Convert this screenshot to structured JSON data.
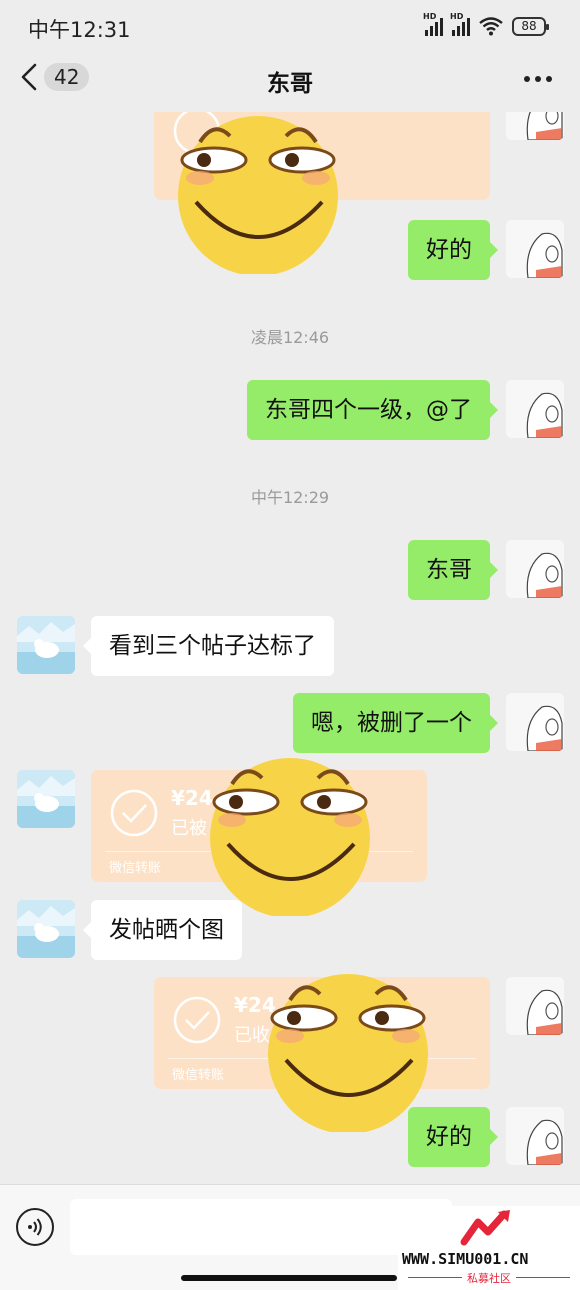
{
  "status_bar": {
    "time": "中午12:31",
    "signal_1_label": "HD",
    "signal_2_label": "HD",
    "wifi_icon": "wifi-icon",
    "battery_level": "88"
  },
  "nav": {
    "back_icon": "chevron-left-icon",
    "unread_count": "42",
    "title": "东哥",
    "more_icon": "more-dots-icon"
  },
  "messages": [
    {
      "sender": "me",
      "type": "transfer",
      "status": "received"
    },
    {
      "sender": "me",
      "type": "text",
      "text": "好的"
    },
    {
      "type": "timestamp",
      "text": "凌晨12:46"
    },
    {
      "sender": "me",
      "type": "text",
      "text": "东哥四个一级，@了"
    },
    {
      "type": "timestamp",
      "text": "中午12:29"
    },
    {
      "sender": "me",
      "type": "text",
      "text": "东哥"
    },
    {
      "sender": "other",
      "type": "text",
      "text": "看到三个帖子达标了"
    },
    {
      "sender": "me",
      "type": "text",
      "text": "嗯，被删了一个"
    },
    {
      "sender": "other",
      "type": "transfer",
      "amount": "¥24",
      "status_text": "已被",
      "footer": "微信转账"
    },
    {
      "sender": "other",
      "type": "text",
      "text": "发帖晒个图"
    },
    {
      "sender": "me",
      "type": "transfer",
      "amount": "¥24",
      "status_text": "已收",
      "footer": "微信转账"
    },
    {
      "sender": "me",
      "type": "text",
      "text": "好的"
    }
  ],
  "input_bar": {
    "voice_icon": "voice-icon",
    "placeholder": ""
  },
  "watermark": {
    "url": "WWW.SIMU001.CN",
    "subtitle": "私募社区"
  },
  "colors": {
    "background": "#ededed",
    "my_bubble": "#95ec69",
    "their_bubble": "#ffffff",
    "transfer_card": "#fde1c6",
    "sticker_face": "#f7d447",
    "watermark_red": "#e5263a"
  }
}
